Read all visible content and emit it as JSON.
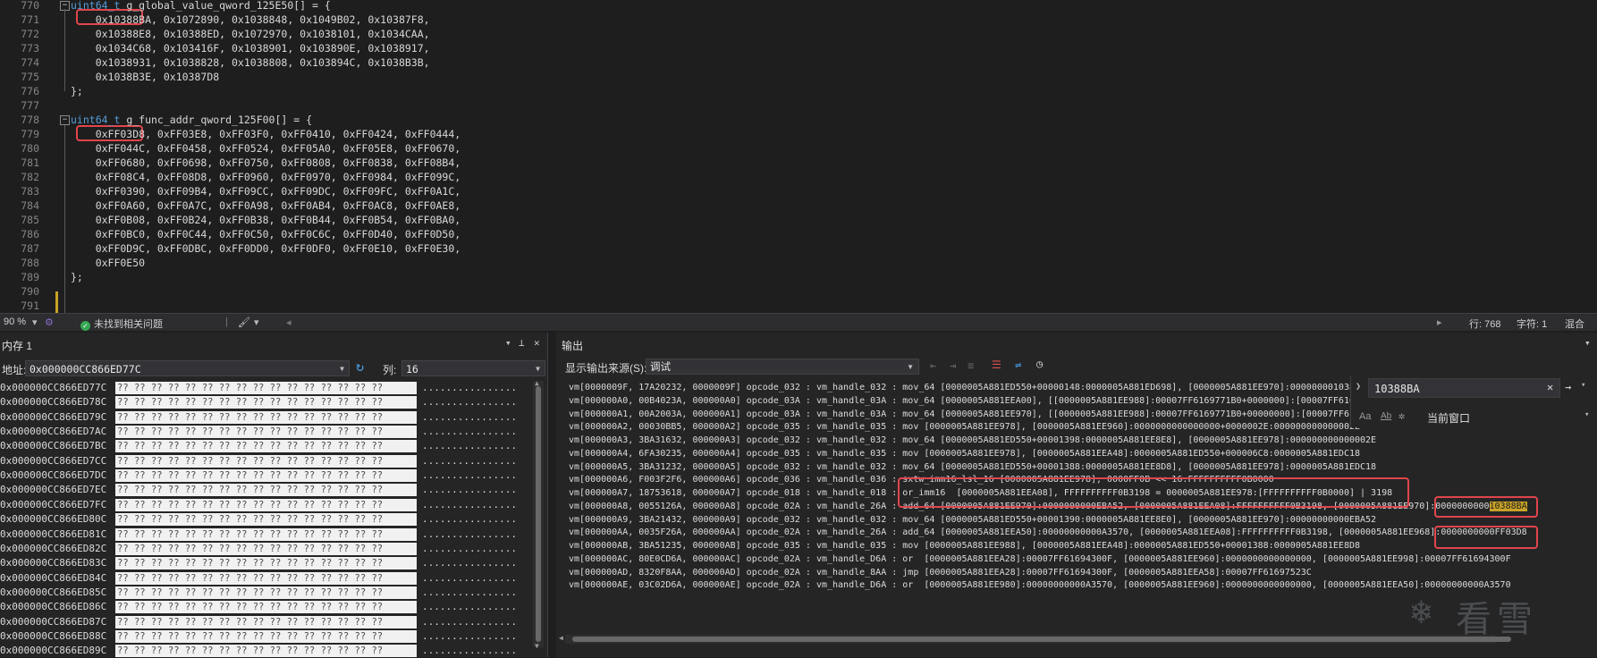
{
  "editor": {
    "lines": [
      {
        "num": "770",
        "kw": "uint64_t",
        "rest": " g_global_value_qword_125E50[] = {",
        "fold": "minus"
      },
      {
        "num": "771",
        "code": "    0x10388BA, 0x1072890, 0x1038848, 0x1049B02, 0x10387F8,"
      },
      {
        "num": "772",
        "code": "    0x10388E8, 0x10388ED, 0x1072970, 0x1038101, 0x1034CAA,"
      },
      {
        "num": "773",
        "code": "    0x1034C68, 0x103416F, 0x1038901, 0x103890E, 0x1038917,"
      },
      {
        "num": "774",
        "code": "    0x1038931, 0x1038828, 0x1038808, 0x103894C, 0x1038B3B,"
      },
      {
        "num": "775",
        "code": "    0x1038B3E, 0x10387D8"
      },
      {
        "num": "776",
        "code": "};"
      },
      {
        "num": "777",
        "code": ""
      },
      {
        "num": "778",
        "kw": "uint64_t",
        "rest": " g_func_addr_qword_125F00[] = {",
        "fold": "minus"
      },
      {
        "num": "779",
        "code": "    0xFF03D8, 0xFF03E8, 0xFF03F0, 0xFF0410, 0xFF0424, 0xFF0444,"
      },
      {
        "num": "780",
        "code": "    0xFF044C, 0xFF0458, 0xFF0524, 0xFF05A0, 0xFF05E8, 0xFF0670,"
      },
      {
        "num": "781",
        "code": "    0xFF0680, 0xFF0698, 0xFF0750, 0xFF0808, 0xFF0838, 0xFF08B4,"
      },
      {
        "num": "782",
        "code": "    0xFF08C4, 0xFF08D8, 0xFF0960, 0xFF0970, 0xFF0984, 0xFF099C,"
      },
      {
        "num": "783",
        "code": "    0xFF0390, 0xFF09B4, 0xFF09CC, 0xFF09DC, 0xFF09FC, 0xFF0A1C,"
      },
      {
        "num": "784",
        "code": "    0xFF0A60, 0xFF0A7C, 0xFF0A98, 0xFF0AB4, 0xFF0AC8, 0xFF0AE8,"
      },
      {
        "num": "785",
        "code": "    0xFF0B08, 0xFF0B24, 0xFF0B38, 0xFF0B44, 0xFF0B54, 0xFF0BA0,"
      },
      {
        "num": "786",
        "code": "    0xFF0BC0, 0xFF0C44, 0xFF0C50, 0xFF0C6C, 0xFF0D40, 0xFF0D50,"
      },
      {
        "num": "787",
        "code": "    0xFF0D9C, 0xFF0DBC, 0xFF0DD0, 0xFF0DF0, 0xFF0E10, 0xFF0E30,"
      },
      {
        "num": "788",
        "code": "    0xFF0E50"
      },
      {
        "num": "789",
        "code": "};"
      },
      {
        "num": "790",
        "code": ""
      },
      {
        "num": "791",
        "code": ""
      }
    ]
  },
  "status_bar": {
    "zoom": "90 %",
    "issues": "未找到相关问题",
    "row": "行: 768",
    "char": "字符: 1",
    "mode": "混合"
  },
  "memory": {
    "title": "内存 1",
    "address_label": "地址:",
    "address_value": "0x000000CC866ED77C",
    "column_label": "列:",
    "column_value": "16",
    "hex_placeholder": "?? ?? ?? ?? ?? ?? ?? ?? ?? ?? ?? ?? ?? ?? ?? ??",
    "ascii_placeholder": "................",
    "rows": [
      "0x000000CC866ED77C",
      "0x000000CC866ED78C",
      "0x000000CC866ED79C",
      "0x000000CC866ED7AC",
      "0x000000CC866ED7BC",
      "0x000000CC866ED7CC",
      "0x000000CC866ED7DC",
      "0x000000CC866ED7EC",
      "0x000000CC866ED7FC",
      "0x000000CC866ED80C",
      "0x000000CC866ED81C",
      "0x000000CC866ED82C",
      "0x000000CC866ED83C",
      "0x000000CC866ED84C",
      "0x000000CC866ED85C",
      "0x000000CC866ED86C",
      "0x000000CC866ED87C",
      "0x000000CC866ED88C",
      "0x000000CC866ED89C"
    ]
  },
  "output": {
    "title": "输出",
    "source_label": "显示输出来源(S):",
    "source_value": "调试",
    "find_text": "10388BA",
    "find_scope": "当前窗口",
    "find_opt_case": "Aa",
    "find_opt_word": "Ab",
    "lines": [
      "vm[0000009F, 17A20232, 0000009F] opcode_032 : vm_handle_032 : mov_64 [0000005A881ED550+00000148:0000005A881ED698], [0000005A881EE970]:0000000010387D",
      "vm[000000A0, 00B4023A, 000000A0] opcode_03A : vm_handle_03A : mov_64 [0000005A881EEA00], [[0000005A881EE988]:00007FF6169771B0+0000000]:[00007FF6169",
      "vm[000000A1, 00A2003A, 000000A1] opcode_03A : vm_handle_03A : mov_64 [0000005A881EE970], [[0000005A881EE988]:00007FF6169771B0+00000000]:[00007FF6169",
      "vm[000000A2, 00030BB5, 000000A2] opcode_035 : vm_handle_035 : mov [0000005A881EE978], [0000005A881EE960]:0000000000000000+0000002E:000000000000002E",
      "vm[000000A3, 3BA31632, 000000A3] opcode_032 : vm_handle_032 : mov_64 [0000005A881ED550+00001398:0000005A881EE8E8], [0000005A881EE978]:000000000000002E",
      "vm[000000A4, 6FA30235, 000000A4] opcode_035 : vm_handle_035 : mov [0000005A881EE978], [0000005A881EEA48]:0000005A881ED550+000006C8:0000005A881EDC18",
      "vm[000000A5, 3BA31232, 000000A5] opcode_032 : vm_handle_032 : mov_64 [0000005A881ED550+00001388:0000005A881EE8D8], [0000005A881EE978]:0000005A881EDC18",
      "vm[000000A6, F003F2F6, 000000A6] opcode_036 : vm_handle_036 : sxtw_imm16_lsl_16 [0000005A881EE978], 0000FF0B << 16:FFFFFFFFFF0B0000",
      "vm[000000A7, 18753618, 000000A7] opcode_018 : vm_handle_018 : or_imm16  [0000005A881EEA08], FFFFFFFFFF0B3198 = 0000005A881EE978:[FFFFFFFFFF0B0000] | 3198",
      "vm[000000A8, 0055126A, 000000A8] opcode_02A : vm_handle_26A : add_64 [0000005A881EE970]:0000000000EBA52, [0000005A881EEA08]:FFFFFFFFFF0B3198, [0000005A881EE970]:000000000010388BA",
      "vm[000000A9, 3BA21432, 000000A9] opcode_032 : vm_handle_032 : mov_64 [0000005A881ED550+00001390:0000005A881EE8E0], [0000005A881EE970]:00000000000EBA52",
      "vm[000000AA, 0035F26A, 000000AA] opcode_02A : vm_handle_26A : add_64 [0000005A881EEA50]:00000000000A3570, [0000005A881EEA08]:FFFFFFFFFF0B3198, [0000005A881EE968]:0000000000FF03D8",
      "vm[000000AB, 3BA51235, 000000AB] opcode_035 : vm_handle_035 : mov [0000005A881EE988], [0000005A881EEA48]:0000005A881ED550+00001388:0000005A881EE8D8",
      "vm[000000AC, 80E0CD6A, 000000AC] opcode_02A : vm_handle_D6A : or  [0000005A881EEA28]:00007FF61694300F, [0000005A881EE960]:0000000000000000, [0000005A881EE998]:00007FF61694300F",
      "vm[000000AD, 8320F8AA, 000000AD] opcode_02A : vm_handle_8AA : jmp [0000005A881EEA28]:00007FF61694300F, [0000005A881EEA58]:00007FF61697523C",
      "vm[000000AE, 03C02D6A, 000000AE] opcode_02A : vm_handle_D6A : or  [0000005A881EE980]:00000000000A3570, [0000005A881EE960]:0000000000000000, [0000005A881EEA50]:00000000000A3570"
    ]
  },
  "watermark": "看雪",
  "colors": {
    "highlight_box": "#e0454c",
    "keyword": "#569cd6",
    "search_match": "#c9a227"
  }
}
